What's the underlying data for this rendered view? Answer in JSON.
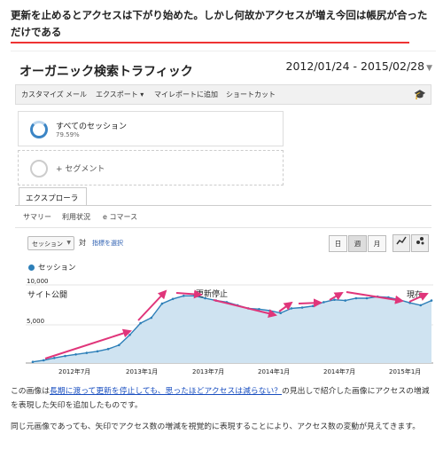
{
  "article": {
    "headline": "更新を止めるとアクセスは下がり始めた。しかし何故かアクセスが増え今回は帳尻が合っただけである",
    "para1_before": "この画像は",
    "para1_link": "長期に渡って更新を停止しても、思ったほどアクセスは減らない？",
    "para1_after": "の見出しで紹介した画像にアクセスの増減を表現した矢印を追加したものです。",
    "para2": "同じ元画像であっても、矢印でアクセス数の増減を視覚的に表現することにより、アクセス数の変動が見えてきます。"
  },
  "ga": {
    "title": "オーガニック検索トラフィック",
    "date_range": "2012/01/24 - 2015/02/28",
    "toolbar": [
      "カスタマイズ",
      "メール",
      "エクスポート ▾",
      "マイレポートに追加",
      "ショートカット"
    ],
    "segment_all": {
      "title": "すべてのセッション",
      "percent": "79.59%"
    },
    "segment_add": "+ セグメント",
    "explorer_tab": "エクスプローラ",
    "subtabs": [
      "サマリー",
      "利用状況",
      "e コマース"
    ],
    "metric_selector": "セッション",
    "vs_label": "対",
    "pick_metric": "指標を選択",
    "granularity": [
      "日",
      "週",
      "月"
    ],
    "legend": "セッション"
  },
  "chart_data": {
    "type": "area",
    "series": [
      {
        "name": "セッション",
        "x": [
          "2012-01",
          "2012-02",
          "2012-03",
          "2012-04",
          "2012-05",
          "2012-06",
          "2012-07",
          "2012-08",
          "2012-09",
          "2012-10",
          "2012-11",
          "2012-12",
          "2013-01",
          "2013-02",
          "2013-03",
          "2013-04",
          "2013-05",
          "2013-06",
          "2013-07",
          "2013-08",
          "2013-09",
          "2013-10",
          "2013-11",
          "2013-12",
          "2014-01",
          "2014-02",
          "2014-03",
          "2014-04",
          "2014-05",
          "2014-06",
          "2014-07",
          "2014-08",
          "2014-09",
          "2014-10",
          "2014-11",
          "2014-12",
          "2015-01",
          "2015-02"
        ],
        "values": [
          150,
          350,
          650,
          900,
          1100,
          1300,
          1500,
          1800,
          2300,
          3600,
          5100,
          5800,
          7600,
          8200,
          8600,
          8600,
          8300,
          8000,
          7800,
          7400,
          7000,
          6900,
          6700,
          6400,
          7000,
          7100,
          7300,
          7800,
          8100,
          8000,
          8300,
          8300,
          8500,
          8400,
          8100,
          7700,
          7400,
          8000
        ]
      }
    ],
    "yticks": [
      "10,000",
      "5,000"
    ],
    "ylim": [
      0,
      10000
    ],
    "xticks": [
      "2012年7月",
      "2013年1月",
      "2013年7月",
      "2014年1月",
      "2014年7月",
      "2015年1月"
    ],
    "annotations": [
      "サイト公開",
      "更新停止",
      "現在"
    ],
    "colors": {
      "line": "#2d7fb8",
      "fill": "#cfe3f1",
      "arrow": "#e0357a"
    }
  }
}
